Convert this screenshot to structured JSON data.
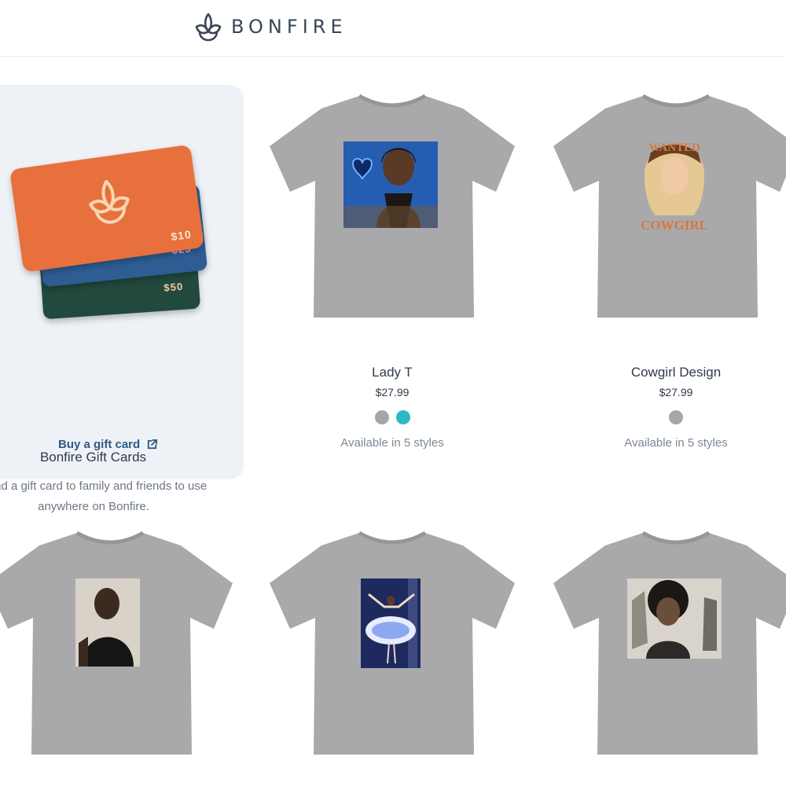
{
  "header": {
    "brand_name": "BONFIRE",
    "logo_icon": "bonfire-lotus-logo"
  },
  "gift_card": {
    "title": "Bonfire Gift Cards",
    "description": "Send a gift card to family and friends to use anywhere on Bonfire.",
    "link_label": "Buy a gift card",
    "link_icon": "external-link-icon",
    "cards": [
      {
        "amount": "$10",
        "color": "#e8703e"
      },
      {
        "amount": "$25",
        "color": "#2f5d94"
      },
      {
        "amount": "$50",
        "color": "#234a3c"
      }
    ]
  },
  "products": [
    {
      "name": "Lady T",
      "price": "$27.99",
      "swatches": [
        "#a6a6aa",
        "#2db8c5"
      ],
      "styles_text": "Available in 5 styles"
    },
    {
      "name": "Cowgirl Design",
      "price": "$27.99",
      "swatches": [
        "#a6a6aa"
      ],
      "styles_text": "Available in 5 styles",
      "print_text": {
        "top": "WANTED",
        "bottom": "COWGIRL"
      }
    },
    {
      "name": "",
      "price": "",
      "swatches": [],
      "styles_text": ""
    },
    {
      "name": "",
      "price": "",
      "swatches": [],
      "styles_text": ""
    },
    {
      "name": "",
      "price": "",
      "swatches": [],
      "styles_text": ""
    }
  ],
  "colors": {
    "shirt_heather_gray": "#a9a9ab",
    "panel_bg": "#eef2f7",
    "link_blue": "#2e5a86"
  }
}
